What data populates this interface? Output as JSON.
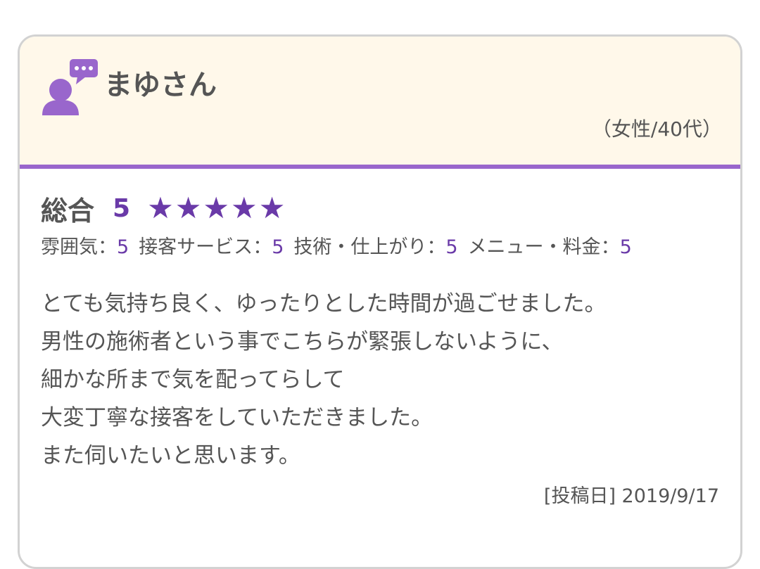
{
  "reviewer": {
    "name": "まゆさん",
    "meta": "（女性/40代）",
    "avatar_icon": "user-comment-icon"
  },
  "rating": {
    "overall_label": "総合",
    "overall_score": "5",
    "stars_value": 5,
    "stars_max": 5,
    "star_glyph": "★",
    "star_color": "#6a3aa8",
    "sub": [
      {
        "label": "雰囲気",
        "sep": "：",
        "value": "5"
      },
      {
        "label": "接客サービス",
        "sep": "：",
        "value": "5"
      },
      {
        "label": "技術・仕上がり",
        "sep": "：",
        "value": "5"
      },
      {
        "label": "メニュー・料金",
        "sep": "：",
        "value": "5"
      }
    ]
  },
  "review": {
    "lines": [
      "とても気持ち良く、ゆったりとした時間が過ごせました。",
      "男性の施術者という事でこちらが緊張しないように、",
      "細かな所まで気を配ってらして",
      "大変丁寧な接客をしていただきました。",
      "また伺いたいと思います。"
    ],
    "date": "[投稿日] 2019/9/17"
  },
  "colors": {
    "accent": "#9966cc",
    "header_bg": "#fff8ea",
    "score": "#6a3aa8",
    "text": "#555555"
  }
}
